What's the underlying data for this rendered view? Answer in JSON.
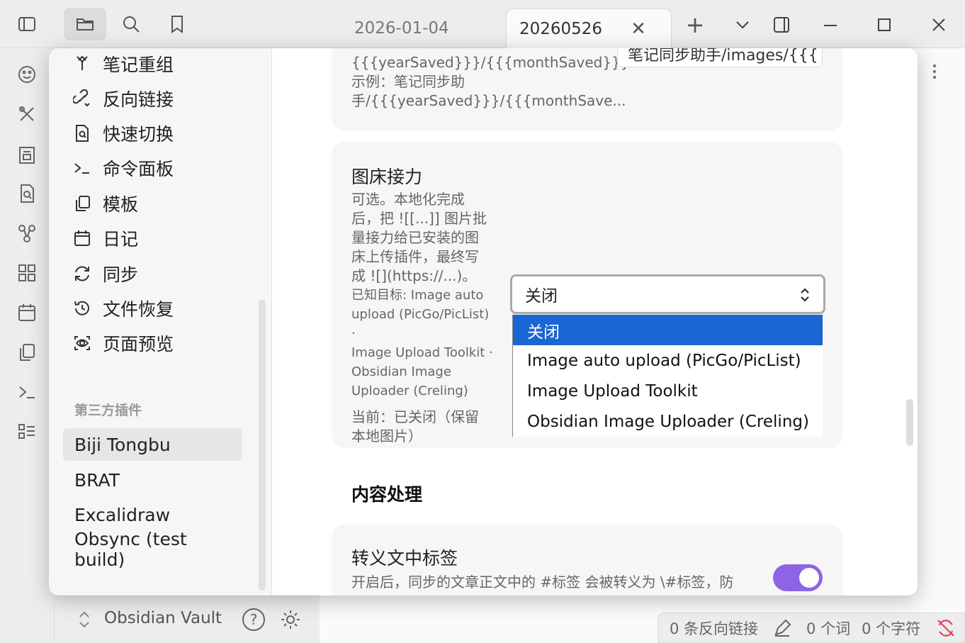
{
  "titlebar": {
    "tabs": [
      {
        "label": "2026-01-04",
        "active": false
      },
      {
        "label": "20260526",
        "active": true
      }
    ],
    "tab_close_glyph": "✕",
    "new_tab_glyph": "+"
  },
  "sidebar_bottom": {
    "vault_name": "Obsidian Vault",
    "help_glyph": "?"
  },
  "statusbar": {
    "backlinks": "0 条反向链接",
    "words": "0 个词",
    "chars": "0 个字符"
  },
  "settings_nav": {
    "core_items": [
      {
        "label": "笔记重组",
        "icon": "merge-icon"
      },
      {
        "label": "反向链接",
        "icon": "backlink-icon"
      },
      {
        "label": "快速切换",
        "icon": "file-search-icon"
      },
      {
        "label": "命令面板",
        "icon": "terminal-icon"
      },
      {
        "label": "模板",
        "icon": "copy-icon"
      },
      {
        "label": "日记",
        "icon": "calendar-icon"
      },
      {
        "label": "同步",
        "icon": "refresh-icon"
      },
      {
        "label": "文件恢复",
        "icon": "history-icon"
      },
      {
        "label": "页面预览",
        "icon": "scan-eye-icon"
      }
    ],
    "third_party_heading": "第三方插件",
    "plugins": [
      {
        "label": "Biji Tongbu",
        "selected": true
      },
      {
        "label": "BRAT",
        "selected": false
      },
      {
        "label": "Excalidraw",
        "selected": false
      },
      {
        "label": "Obsync (test build)",
        "selected": false
      }
    ]
  },
  "content": {
    "prev_setting": {
      "desc_lines": [
        "{{{yearSaved}}}/{{{monthSaved}}}...",
        "示例：笔记同步助",
        "手/{{{yearSaved}}}/{{{monthSave..."
      ],
      "input_value": "笔记同步助手/images/{{{"
    },
    "image_relay": {
      "title": "图床接力",
      "desc_lines": [
        "可选。本地化完成",
        "后，把 ![[...]] 图片批",
        "量接力给已安装的图",
        "床上传插件，最终写",
        "成 ![](https://...)。"
      ],
      "known_lines": [
        "已知目标: Image auto",
        "upload (PicGo/PicList) ·",
        "Image Upload Toolkit ·",
        "Obsidian Image",
        "Uploader (Creling)"
      ],
      "current_lines": [
        "当前：已关闭（保留",
        "本地图片）"
      ],
      "select_value": "关闭",
      "options": [
        {
          "label": "关闭",
          "selected": true
        },
        {
          "label": "Image auto upload (PicGo/PicList)",
          "selected": false
        },
        {
          "label": "Image Upload Toolkit",
          "selected": false
        },
        {
          "label": "Obsidian Image Uploader (Creling)",
          "selected": false
        }
      ]
    },
    "section_heading": "内容处理",
    "escape_tags": {
      "title": "转义文中标签",
      "desc": "开启后，同步的文章正文中的 #标签 会被转义为 \\#标签，防",
      "enabled": true
    }
  },
  "colors": {
    "accent": "#8e63e6",
    "selection": "#1a66d2"
  }
}
